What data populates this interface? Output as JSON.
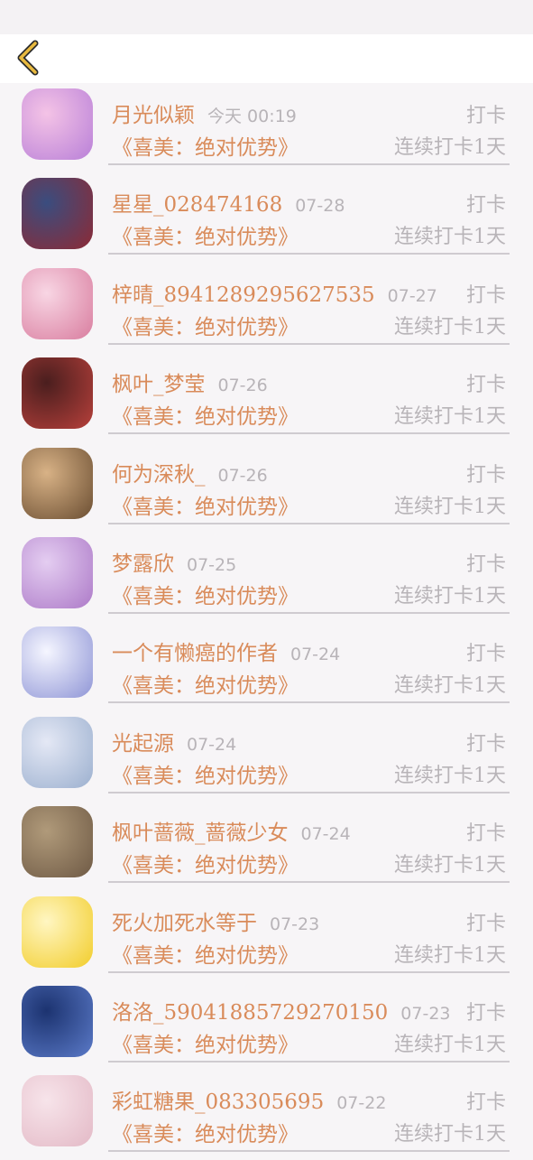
{
  "header": {
    "back_icon": "chevron-left-icon",
    "accent": "#e8b93f"
  },
  "colors": {
    "name": "#d98b5a",
    "muted": "#b8b4b8",
    "background": "#f7f5f7"
  },
  "entries": [
    {
      "name": "月光似颖",
      "date": "今天 00:19",
      "action": "打卡",
      "book": "《喜美：绝对优势》",
      "streak": "连续打卡1天",
      "avatar_colors": [
        "#f4c3e6",
        "#b980d8"
      ]
    },
    {
      "name": "星星_028474168",
      "date": "07-28",
      "action": "打卡",
      "book": "《喜美：绝对优势》",
      "streak": "连续打卡1天",
      "avatar_colors": [
        "#3a4d7f",
        "#8d2a35"
      ]
    },
    {
      "name": "梓晴_8941289295627535",
      "date": "07-27",
      "action": "打卡",
      "book": "《喜美：绝对优势》",
      "streak": "连续打卡1天",
      "avatar_colors": [
        "#f8d6e4",
        "#d97d9f"
      ]
    },
    {
      "name": "枫叶_梦莹",
      "date": "07-26",
      "action": "打卡",
      "book": "《喜美：绝对优势》",
      "streak": "连续打卡1天",
      "avatar_colors": [
        "#4a1e1e",
        "#b7403b"
      ]
    },
    {
      "name": "何为深秋_",
      "date": "07-26",
      "action": "打卡",
      "book": "《喜美：绝对优势》",
      "streak": "连续打卡1天",
      "avatar_colors": [
        "#d8b286",
        "#6b4e32"
      ]
    },
    {
      "name": "梦露欣",
      "date": "07-25",
      "action": "打卡",
      "book": "《喜美：绝对优势》",
      "streak": "连续打卡1天",
      "avatar_colors": [
        "#e4cdf1",
        "#ad7ac8"
      ]
    },
    {
      "name": "一个有懒癌的作者",
      "date": "07-24",
      "action": "打卡",
      "book": "《喜美：绝对优势》",
      "streak": "连续打卡1天",
      "avatar_colors": [
        "#f5f6ff",
        "#8f95d6"
      ]
    },
    {
      "name": "光起源",
      "date": "07-24",
      "action": "打卡",
      "book": "《喜美：绝对优势》",
      "streak": "连续打卡1天",
      "avatar_colors": [
        "#e4e8f5",
        "#9cb0cf"
      ]
    },
    {
      "name": "枫叶蔷薇_蔷薇少女",
      "date": "07-24",
      "action": "打卡",
      "book": "《喜美：绝对优势》",
      "streak": "连续打卡1天",
      "avatar_colors": [
        "#b09a7a",
        "#6f5a45"
      ]
    },
    {
      "name": "死火加死水等于",
      "date": "07-23",
      "action": "打卡",
      "book": "《喜美：绝对优势》",
      "streak": "连续打卡1天",
      "avatar_colors": [
        "#fff6c2",
        "#f2cd2b"
      ]
    },
    {
      "name": "洛洛_59041885729270150",
      "date": "07-23",
      "action": "打卡",
      "book": "《喜美：绝对优势》",
      "streak": "连续打卡1天",
      "avatar_colors": [
        "#1c3370",
        "#5b7ac8"
      ]
    },
    {
      "name": "彩虹糖果_083305695",
      "date": "07-22",
      "action": "打卡",
      "book": "《喜美：绝对优势》",
      "streak": "连续打卡1天",
      "avatar_colors": [
        "#f7e4ea",
        "#e3b9c6"
      ]
    }
  ]
}
